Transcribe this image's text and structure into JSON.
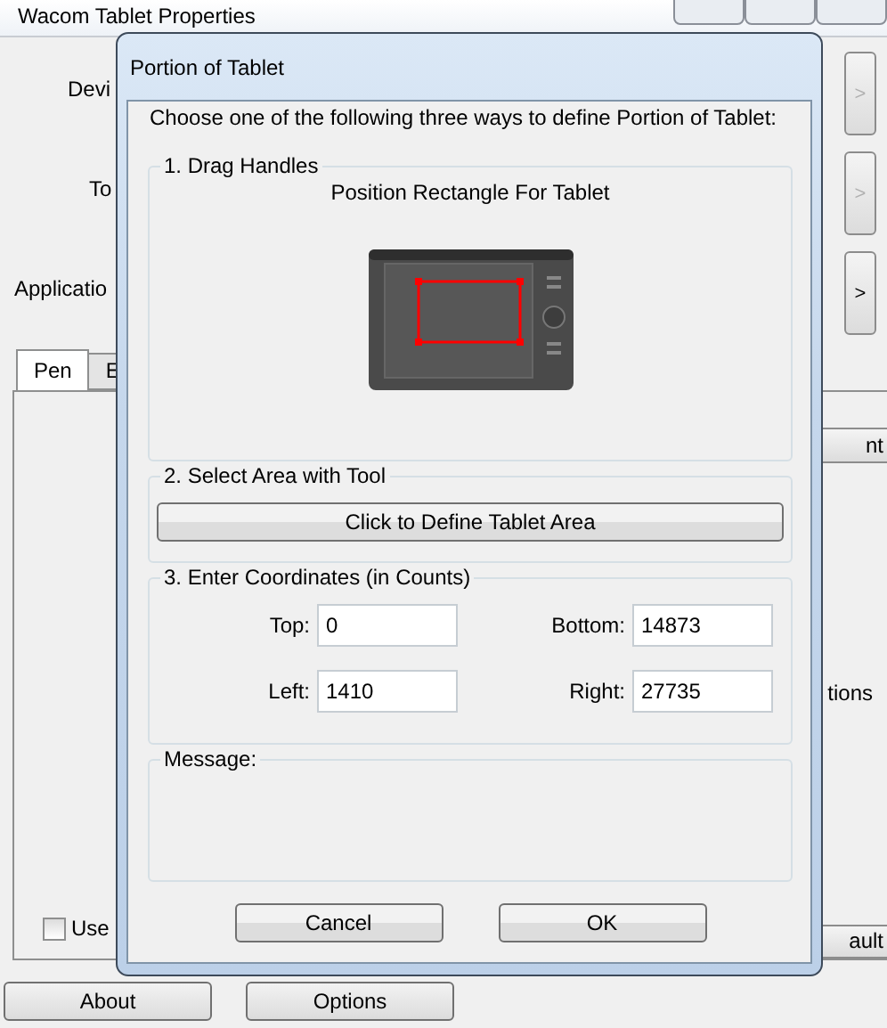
{
  "background_window": {
    "title": "Wacom Tablet Properties",
    "labels": [
      "Devi",
      "To",
      "Applicatio"
    ],
    "side_buttons": [
      {
        "text": ">",
        "disabled": true
      },
      {
        "text": ">",
        "disabled": true
      },
      {
        "text": ">",
        "disabled": false
      }
    ],
    "tabs": [
      {
        "label": "Pen",
        "selected": true
      },
      {
        "label": "E",
        "selected": false
      }
    ],
    "panel_fragments": [
      {
        "kind": "button",
        "text": "nt"
      },
      {
        "kind": "label",
        "text": "tions"
      },
      {
        "kind": "button",
        "text": "ault"
      }
    ],
    "checkbox": {
      "label": "Use",
      "checked": false
    },
    "bottom_buttons": [
      "About",
      "Options"
    ]
  },
  "dialog": {
    "title": "Portion of Tablet",
    "intro": "Choose one of the following three ways to define Portion of Tablet:",
    "drag_handles": {
      "legend": "1. Drag Handles",
      "caption": "Position Rectangle For Tablet"
    },
    "select_area": {
      "legend": "2. Select Area with Tool",
      "button": "Click to Define Tablet Area"
    },
    "coordinates": {
      "legend": "3. Enter Coordinates (in Counts)",
      "fields": [
        {
          "label": "Top:",
          "value": "0"
        },
        {
          "label": "Bottom:",
          "value": "14873"
        },
        {
          "label": "Left:",
          "value": "1410"
        },
        {
          "label": "Right:",
          "value": "27735"
        }
      ]
    },
    "message": {
      "legend": "Message:"
    },
    "buttons": [
      "Cancel",
      "OK"
    ]
  }
}
